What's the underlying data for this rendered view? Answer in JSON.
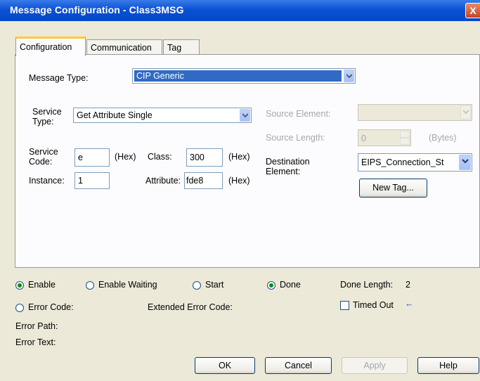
{
  "window": {
    "title": "Message Configuration - Class3MSG",
    "close_glyph": "X"
  },
  "tabs": [
    {
      "label": "Configuration",
      "active": true
    },
    {
      "label": "Communication",
      "active": false
    },
    {
      "label": "Tag",
      "active": false
    }
  ],
  "config": {
    "message_type_label": "Message Type:",
    "message_type_value": "CIP Generic",
    "service_type_label_1": "Service",
    "service_type_label_2": "Type:",
    "service_type_value": "Get Attribute Single",
    "service_code_label_1": "Service",
    "service_code_label_2": "Code:",
    "service_code_value": "e",
    "hex_label": "(Hex)",
    "class_label": "Class:",
    "class_value": "300",
    "instance_label": "Instance:",
    "instance_value": "1",
    "attribute_label": "Attribute:",
    "attribute_value": "fde8",
    "source_element_label": "Source Element:",
    "source_element_value": "",
    "source_length_label": "Source Length:",
    "source_length_value": "0",
    "bytes_label": "(Bytes)",
    "destination_label_1": "Destination",
    "destination_label_2": "Element:",
    "destination_value": "EIPS_Connection_St",
    "new_tag_label": "New Tag..."
  },
  "status": {
    "enable_label": "Enable",
    "enable_checked": true,
    "enable_waiting_label": "Enable Waiting",
    "start_label": "Start",
    "done_label": "Done",
    "done_checked": true,
    "done_length_label": "Done Length:",
    "done_length_value": "2",
    "error_code_label": "Error Code:",
    "extended_error_label": "Extended Error Code:",
    "timed_out_label": "Timed Out",
    "timed_out_arrow": "←",
    "error_path_label": "Error Path:",
    "error_text_label": "Error Text:"
  },
  "buttons": {
    "ok": "OK",
    "cancel": "Cancel",
    "apply": "Apply",
    "help": "Help"
  },
  "colors": {
    "title_bar": "#0a52d6",
    "dialog_bg": "#ece9d8",
    "active_tab_accent": "#ffc83c",
    "selection": "#316ac5"
  }
}
